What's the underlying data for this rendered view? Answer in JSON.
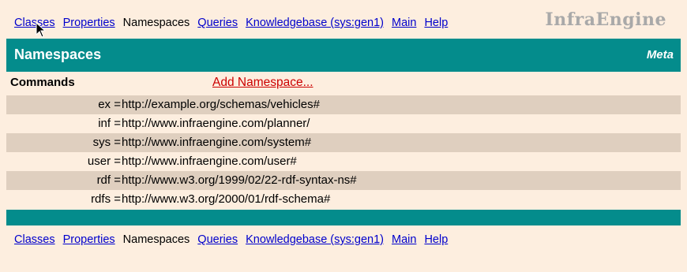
{
  "nav": {
    "items": [
      {
        "label": "Classes",
        "link": true
      },
      {
        "label": "Properties",
        "link": true
      },
      {
        "label": "Namespaces",
        "link": false
      },
      {
        "label": "Queries",
        "link": true
      },
      {
        "label": "Knowledgebase (sys:gen1)",
        "link": true
      },
      {
        "label": "Main",
        "link": true
      },
      {
        "label": "Help",
        "link": true
      }
    ]
  },
  "brand": "InfraEngine",
  "header": {
    "title": "Namespaces",
    "meta": "Meta"
  },
  "commands": {
    "label": "Commands",
    "add_namespace": "Add Namespace..."
  },
  "namespaces": [
    {
      "prefix": "ex =",
      "uri": "http://example.org/schemas/vehicles#"
    },
    {
      "prefix": "inf =",
      "uri": "http://www.infraengine.com/planner/"
    },
    {
      "prefix": "sys =",
      "uri": "http://www.infraengine.com/system#"
    },
    {
      "prefix": "user =",
      "uri": "http://www.infraengine.com/user#"
    },
    {
      "prefix": "rdf =",
      "uri": "http://www.w3.org/1999/02/22-rdf-syntax-ns#"
    },
    {
      "prefix": "rdfs =",
      "uri": "http://www.w3.org/2000/01/rdf-schema#"
    }
  ],
  "colors": {
    "teal": "#048c8c",
    "background": "#fdeedf",
    "stripe": "#dfcfbf",
    "link": "#0000cc",
    "command_link": "#cc0000"
  }
}
